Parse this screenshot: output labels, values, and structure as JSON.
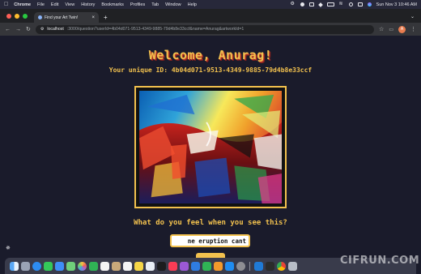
{
  "menubar": {
    "app_name": "Chrome",
    "items": [
      "File",
      "Edit",
      "View",
      "History",
      "Bookmarks",
      "Profiles",
      "Tab",
      "Window",
      "Help"
    ],
    "datetime": "Sun Nov 3  10:46 AM"
  },
  "browser": {
    "tab_title": "Find your Art Twin!",
    "url_host": "localhost",
    "url_path": ":3000/question?userId=4b04d071-9513-4349-9885-79d4b8e33ccf&name=Anurag&artworkId=1",
    "profile_initial": "A"
  },
  "page": {
    "welcome": "Welcome, Anurag!",
    "unique_id": "Your unique ID: 4b04d071-9513-4349-9885-79d4b8e33ccf",
    "question": "What do you feel when you see this?",
    "answer_value": "ne eruption cant"
  },
  "colors": {
    "background": "#1a1b2b",
    "accent": "#f2c14e"
  },
  "watermark": "CIFRUN.COM"
}
